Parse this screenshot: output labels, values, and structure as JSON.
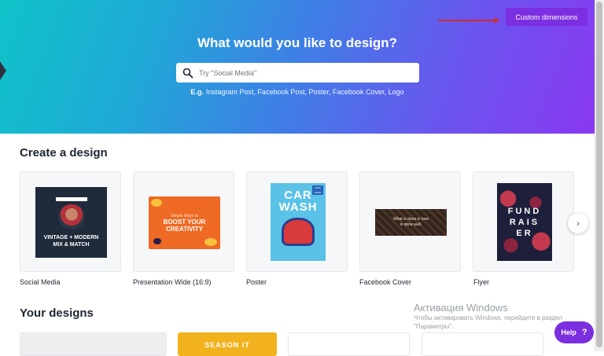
{
  "hero": {
    "title": "What would you like to design?",
    "custom_dimensions": "Custom dimensions",
    "search_placeholder": "Try \"Social Media\"",
    "examples_prefix": "E.g.",
    "examples": [
      "Instagram Post",
      "Facebook Post",
      "Poster",
      "Facebook Cover",
      "Logo"
    ],
    "gradient": [
      "#0fc3c9",
      "#8a38f2"
    ]
  },
  "create": {
    "title": "Create a design",
    "cards": [
      {
        "label": "Social Media",
        "thumb_lines": [
          "VINTAGE + MODERN",
          "MIX & MATCH"
        ]
      },
      {
        "label": "Presentation Wide (16:9)",
        "thumb_lines": [
          "Simple Ways to",
          "BOOST YOUR",
          "CREATIVITY"
        ]
      },
      {
        "label": "Poster",
        "thumb_lines": [
          "CAR",
          "WASH",
          "NOW OPEN"
        ]
      },
      {
        "label": "Facebook Cover",
        "thumb_lines": [
          "What is done in love",
          "is done well."
        ]
      },
      {
        "label": "Flyer",
        "thumb_lines": [
          "FUND",
          "RAIS",
          "ER"
        ]
      }
    ]
  },
  "yours": {
    "title": "Your designs",
    "card_text": "SEASON IT"
  },
  "activation": {
    "title": "Активация Windows",
    "line1": "Чтобы активировать Windows, перейдите в раздел",
    "line2": "\"Параметры\"."
  },
  "help": {
    "label": "Help",
    "icon": "?"
  },
  "colors": {
    "accent": "#7b2fe0",
    "arrow": "#d62a2a"
  }
}
